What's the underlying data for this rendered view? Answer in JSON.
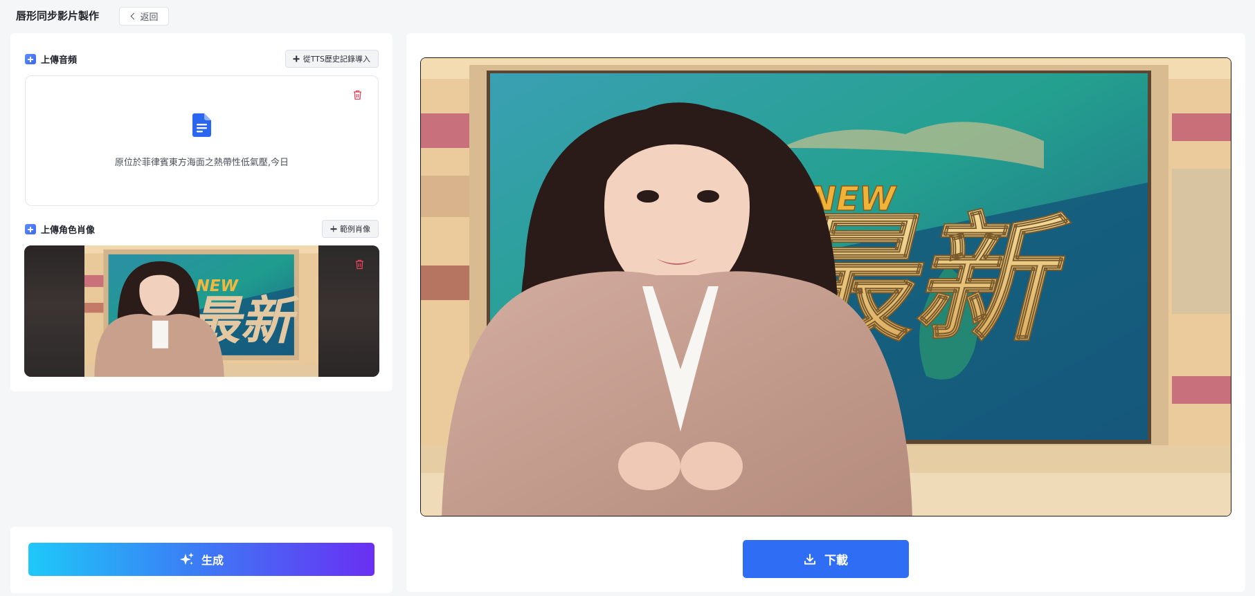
{
  "header": {
    "title": "唇形同步影片製作",
    "back_label": "返回"
  },
  "audio_section": {
    "title": "上傳音頻",
    "import_button": "從TTS歷史記錄導入",
    "file_text": "原位於菲律賓東方海面之熱帶性低氣壓,今日"
  },
  "portrait_section": {
    "title": "上傳角色肖像",
    "sample_button": "範例肖像"
  },
  "generate": {
    "label": "生成"
  },
  "preview": {
    "sign_en": "NEW",
    "sign_zh": "最新",
    "download_label": "下載"
  },
  "colors": {
    "accent_blue": "#2f6df5",
    "delete_red": "#e8415b",
    "gradient_start": "#1ec8f8",
    "gradient_end": "#6a2ff3"
  }
}
